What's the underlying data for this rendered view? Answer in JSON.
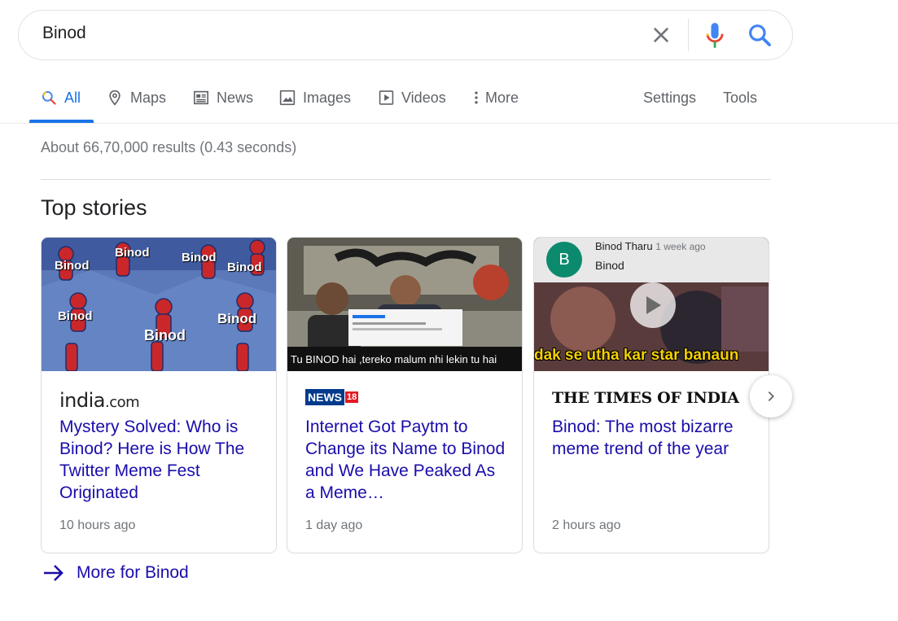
{
  "search": {
    "query": "Binod"
  },
  "tabs": [
    {
      "label": "All",
      "icon": "search-icon"
    },
    {
      "label": "Maps",
      "icon": "map-pin-icon"
    },
    {
      "label": "News",
      "icon": "newspaper-icon"
    },
    {
      "label": "Images",
      "icon": "image-icon"
    },
    {
      "label": "Videos",
      "icon": "play-video-icon"
    },
    {
      "label": "More",
      "icon": "more-vertical-icon"
    }
  ],
  "tools": {
    "settings": "Settings",
    "tools": "Tools"
  },
  "stats": "About 66,70,000 results (0.43 seconds)",
  "top_stories": {
    "title": "Top stories",
    "cards": [
      {
        "source": "india.com",
        "source_logo": {
          "main": "india",
          "suffix": ".com"
        },
        "headline": "Mystery Solved: Who is Binod? Here is How The Twitter Meme Fest Originated",
        "time": "10 hours ago",
        "thumb_labels": [
          "Binod",
          "Binod",
          "Binod",
          "Binod",
          "Binod",
          "Binod",
          "Binod"
        ]
      },
      {
        "source": "NEWS18",
        "source_logo": {
          "main": "NEWS",
          "badge": "18"
        },
        "headline": "Internet Got Paytm to Change its Name to Binod and We Have Peaked As a Meme…",
        "time": "1 day ago",
        "thumb_caption": "Tu BINOD hai ,tereko malum nhi lekin tu hai"
      },
      {
        "source": "THE TIMES OF INDIA",
        "headline": "Binod: The most bizarre meme trend of the year",
        "time": "2 hours ago",
        "thumb_comment": {
          "avatar": "B",
          "author": "Binod Tharu",
          "when": "1 week ago",
          "text": "Binod"
        },
        "thumb_subtitle": "dak se utha kar star banaun"
      }
    ]
  },
  "more_link": "More for Binod",
  "colors": {
    "accent": "#1a73e8",
    "link": "#1a0dab",
    "secondary_text": "#70757a"
  }
}
